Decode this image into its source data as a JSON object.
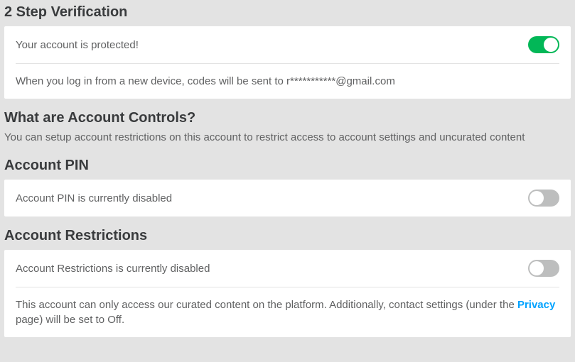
{
  "two_step": {
    "heading": "2 Step Verification",
    "status": "Your account is protected!",
    "enabled": true,
    "desc_prefix": "When you log in from a new device, codes will be sent to ",
    "email": "r***********@gmail.com"
  },
  "account_controls": {
    "heading": "What are Account Controls?",
    "desc": "You can setup account restrictions on this account to restrict access to account settings and uncurated content"
  },
  "account_pin": {
    "heading": "Account PIN",
    "status": "Account PIN is currently disabled",
    "enabled": false
  },
  "account_restrictions": {
    "heading": "Account Restrictions",
    "status": "Account Restrictions is currently disabled",
    "enabled": false,
    "desc_prefix": "This account can only access our curated content on the platform. Additionally, contact settings (under the ",
    "link_text": "Privacy",
    "desc_suffix": " page) will be set to Off."
  }
}
